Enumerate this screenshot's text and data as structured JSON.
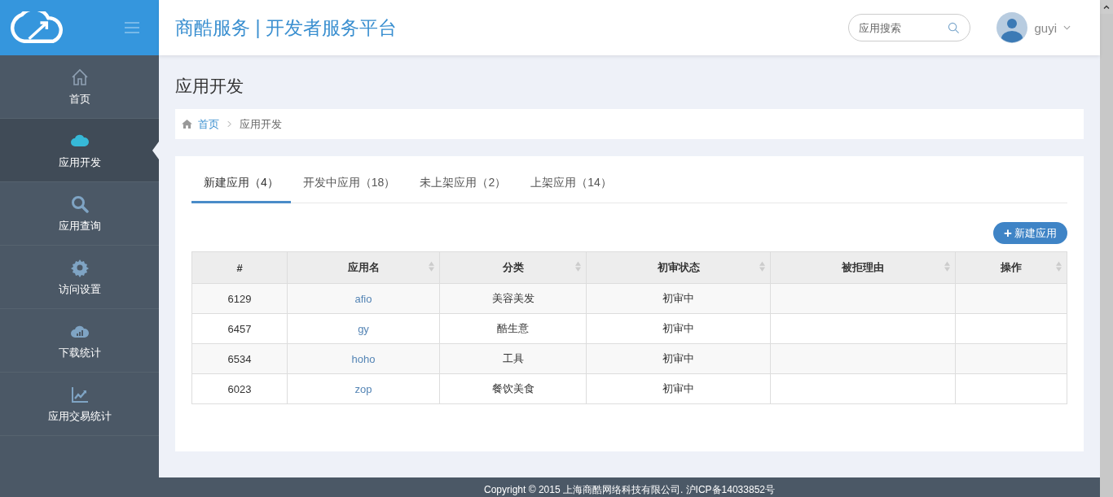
{
  "header": {
    "title": "商酷服务 | 开发者服务平台",
    "search": {
      "placeholder": "应用搜索"
    },
    "user": {
      "name": "guyi"
    }
  },
  "sidebar": {
    "items": [
      {
        "kind": "home",
        "label": "首页",
        "selected": false
      },
      {
        "kind": "cloud",
        "label": "应用开发",
        "selected": true
      },
      {
        "kind": "search",
        "label": "应用查询",
        "selected": false
      },
      {
        "kind": "gear",
        "label": "访问设置",
        "selected": false
      },
      {
        "kind": "cloud-chart",
        "label": "下载统计",
        "selected": false
      },
      {
        "kind": "line-chart",
        "label": "应用交易统计",
        "selected": false
      }
    ]
  },
  "page_title": "应用开发",
  "breadcrumb": [
    {
      "label": "首页",
      "link": true
    },
    {
      "label": "应用开发",
      "link": false
    }
  ],
  "tabs": [
    {
      "label": "新建应用（4）",
      "selected": true
    },
    {
      "label": "开发中应用（18）",
      "selected": false
    },
    {
      "label": "未上架应用（2）",
      "selected": false
    },
    {
      "label": "上架应用（14）",
      "selected": false
    }
  ],
  "new_button": {
    "icon": "+",
    "label": "新建应用"
  },
  "table": {
    "columns": [
      {
        "label": "#",
        "sortable": false
      },
      {
        "label": "应用名",
        "sortable": true
      },
      {
        "label": "分类",
        "sortable": true
      },
      {
        "label": "初审状态",
        "sortable": true
      },
      {
        "label": "被拒理由",
        "sortable": true
      },
      {
        "label": "操作",
        "sortable": true
      }
    ],
    "rows": [
      {
        "id": "6129",
        "name": "afio",
        "category": "美容美发",
        "status": "初审中"
      },
      {
        "id": "6457",
        "name": "gy",
        "category": "酷生意",
        "status": "初审中"
      },
      {
        "id": "6534",
        "name": "hoho",
        "category": "工具",
        "status": "初审中"
      },
      {
        "id": "6023",
        "name": "zop",
        "category": "餐饮美食",
        "status": "初审中"
      }
    ]
  },
  "footer": "Copyright © 2015 上海商酷网络科技有限公司. 沪ICP备14033852号"
}
